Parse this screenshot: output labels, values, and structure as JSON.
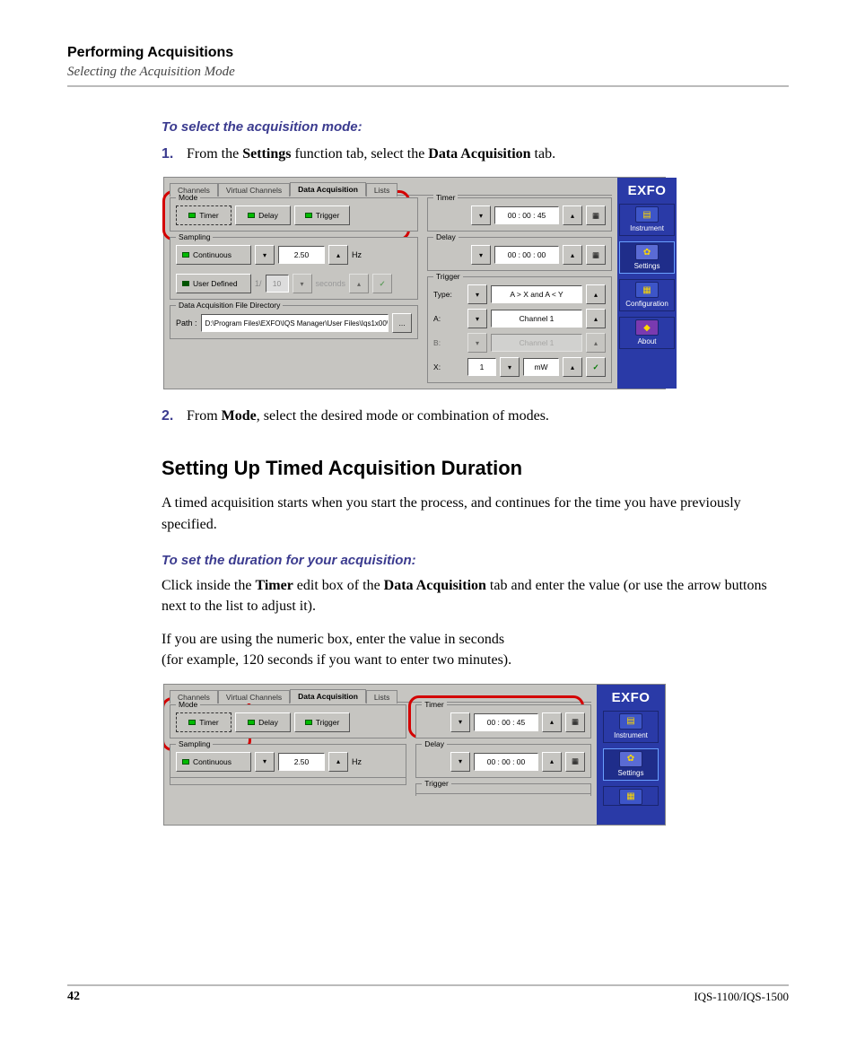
{
  "header": {
    "title": "Performing Acquisitions",
    "subtitle": "Selecting the Acquisition Mode"
  },
  "proc1_title": "To select the acquisition mode:",
  "step1": {
    "num": "1.",
    "pre": "From the ",
    "b1": "Settings",
    "mid": " function tab, select the ",
    "b2": "Data Acquisition",
    "post": " tab."
  },
  "step2": {
    "num": "2.",
    "pre": "From ",
    "b1": "Mode",
    "post": ", select the desired mode or combination of modes."
  },
  "h2": "Setting Up Timed Acquisition Duration",
  "para1": "A timed acquisition starts when you start the process, and continues for the time you have previously specified.",
  "proc2_title": "To set the duration for your acquisition:",
  "para2": {
    "pre": "Click inside the ",
    "b1": "Timer",
    "mid": " edit box of the ",
    "b2": "Data Acquisition",
    "post": " tab and enter the value (or use the arrow buttons next to the list to adjust it)."
  },
  "para3a": "If you are using the numeric box, enter the value in seconds",
  "para3b": "(for example, 120 seconds if you want to enter two minutes).",
  "footer": {
    "page": "42",
    "doc": "IQS-1100/IQS-1500"
  },
  "ui": {
    "brand": "EXFO",
    "side": {
      "instrument": "Instrument",
      "settings": "Settings",
      "configuration": "Configuration",
      "about": "About"
    },
    "tabs": {
      "channels": "Channels",
      "vchannels": "Virtual Channels",
      "da": "Data Acquisition",
      "lists": "Lists"
    },
    "mode": {
      "title": "Mode",
      "timer": "Timer",
      "delay": "Delay",
      "trigger": "Trigger"
    },
    "sampling": {
      "title": "Sampling",
      "continuous": "Continuous",
      "hz": "Hz",
      "rate": "2.50",
      "userdef": "User Defined",
      "userdef_n": "10",
      "userdef_unit": "seconds"
    },
    "dir": {
      "title": "Data Acquisition File Directory",
      "label": "Path :",
      "value": "D:\\Program Files\\EXFO\\IQS Manager\\User Files\\Iqs1x00\\",
      "browse": "..."
    },
    "timer": {
      "title": "Timer",
      "value": "00 : 00 : 45"
    },
    "delay": {
      "title": "Delay",
      "value": "00 : 00 : 00"
    },
    "trigger": {
      "title": "Trigger",
      "type_label": "Type:",
      "type_value": "A > X and A < Y",
      "a_label": "A:",
      "a_value": "Channel 1",
      "b_label": "B:",
      "b_value": "Channel 1",
      "x_label": "X:",
      "x_value": "1",
      "x_unit": "mW"
    },
    "keypad_glyph": "▦"
  }
}
